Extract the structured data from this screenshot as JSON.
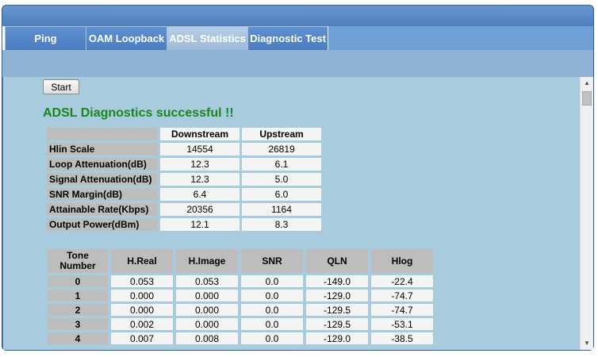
{
  "tabs": [
    {
      "label": "Ping",
      "active": false
    },
    {
      "label": "OAM Loopback",
      "active": false
    },
    {
      "label": "ADSL Statistics",
      "active": true
    },
    {
      "label": "Diagnostic Test",
      "active": false
    }
  ],
  "start_button": "Start",
  "status_message": "ADSL Diagnostics successful !!",
  "stats": {
    "headers": [
      "Downstream",
      "Upstream"
    ],
    "rows": [
      {
        "label": "Hlin Scale",
        "down": "14554",
        "up": "26819"
      },
      {
        "label": "Loop Attenuation(dB)",
        "down": "12.3",
        "up": "6.1"
      },
      {
        "label": "Signal Attenuation(dB)",
        "down": "12.3",
        "up": "5.0"
      },
      {
        "label": "SNR Margin(dB)",
        "down": "6.4",
        "up": "6.0"
      },
      {
        "label": "Attainable Rate(Kbps)",
        "down": "20356",
        "up": "1164"
      },
      {
        "label": "Output Power(dBm)",
        "down": "12.1",
        "up": "8.3"
      }
    ]
  },
  "tones": {
    "headers": [
      "Tone Number",
      "H.Real",
      "H.Image",
      "SNR",
      "QLN",
      "Hlog"
    ],
    "rows": [
      [
        "0",
        "0.053",
        "0.053",
        "0.0",
        "-149.0",
        "-22.4"
      ],
      [
        "1",
        "0.000",
        "0.000",
        "0.0",
        "-129.0",
        "-74.7"
      ],
      [
        "2",
        "0.000",
        "0.000",
        "0.0",
        "-129.5",
        "-74.7"
      ],
      [
        "3",
        "0.002",
        "0.000",
        "0.0",
        "-129.5",
        "-53.1"
      ],
      [
        "4",
        "0.007",
        "0.008",
        "0.0",
        "-129.0",
        "-38.5"
      ]
    ]
  },
  "colors": {
    "accent": "#4a79b4",
    "success": "#17871e",
    "content_bg": "#a8cbdd"
  },
  "icons": {
    "scroll_up": "scroll-up-arrow-icon",
    "scroll_down": "scroll-down-arrow-icon"
  }
}
